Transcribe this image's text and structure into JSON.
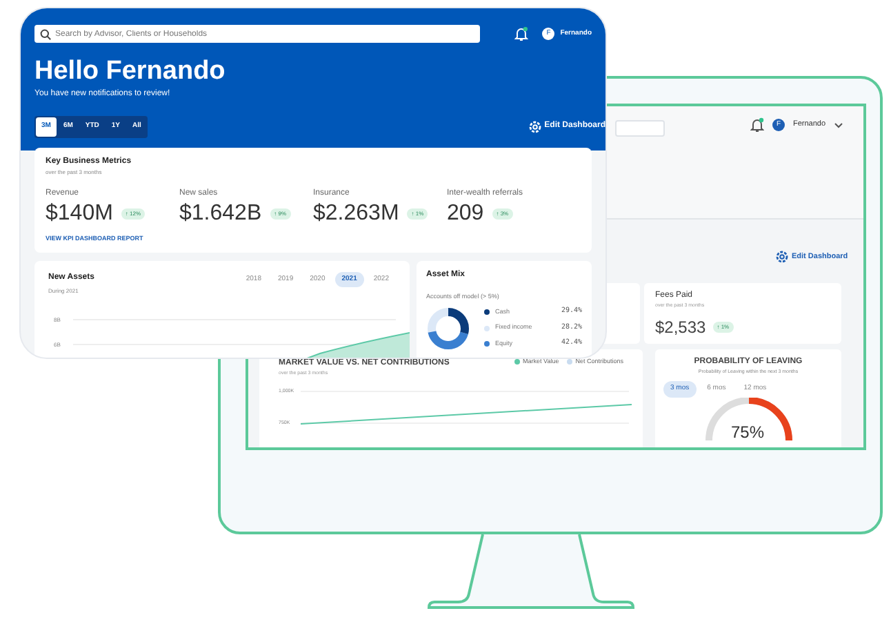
{
  "front": {
    "search": {
      "placeholder": "Search by Advisor, Clients or Households"
    },
    "user": {
      "initial": "F",
      "name": "Fernando"
    },
    "greeting": "Hello Fernando",
    "subtitle": "You have new notifications to review!",
    "periods": [
      {
        "label": "3M",
        "selected": true
      },
      {
        "label": "6M",
        "selected": false
      },
      {
        "label": "YTD",
        "selected": false
      },
      {
        "label": "1Y",
        "selected": false
      },
      {
        "label": "All",
        "selected": false
      }
    ],
    "edit_button": "Edit Dashboard",
    "kpi": {
      "title": "Key Business Metrics",
      "subtitle": "over the past 3 months",
      "metrics": [
        {
          "label": "Revenue",
          "value": "$140M",
          "change": "↑ 12%"
        },
        {
          "label": "New sales",
          "value": "$1.642B",
          "change": "↑ 9%"
        },
        {
          "label": "Insurance",
          "value": "$2.263M",
          "change": "↑ 1%"
        },
        {
          "label": "Inter-wealth referrals",
          "value": "209",
          "change": "↑ 3%"
        }
      ],
      "link": "VIEW KPI DASHBOARD REPORT"
    },
    "new_assets": {
      "title": "New Assets",
      "subtitle": "During 2021",
      "years": [
        {
          "label": "2018",
          "selected": false
        },
        {
          "label": "2019",
          "selected": false
        },
        {
          "label": "2020",
          "selected": false
        },
        {
          "label": "2021",
          "selected": true
        },
        {
          "label": "2022",
          "selected": false
        }
      ],
      "ticks": [
        "8B",
        "6B"
      ]
    },
    "asset_mix": {
      "title": "Asset Mix",
      "subtitle": "Accounts off model (> 5%)",
      "legend": [
        {
          "label": "Cash",
          "value": "29.4%",
          "color": "#0b3b7a"
        },
        {
          "label": "Fixed income",
          "value": "28.2%",
          "color": "#dce8f7"
        },
        {
          "label": "Equity",
          "value": "42.4%",
          "color": "#3a7fd0"
        }
      ]
    }
  },
  "back": {
    "user": {
      "initial": "F",
      "name": "Fernando"
    },
    "edit_button": "Edit Dashboard",
    "fees": {
      "title": "Fees Paid",
      "subtitle": "over the past 3 months",
      "value": "$2,533",
      "change": "↑ 1%"
    },
    "market": {
      "title": "MARKET VALUE VS. NET CONTRIBUTIONS",
      "subtitle": "over the past 3 months",
      "legend": [
        {
          "label": "Market Value",
          "color": "#5cc9a7"
        },
        {
          "label": "Net Contributions",
          "color": "#c9dcf0"
        }
      ],
      "ticks": [
        "1,000K",
        "750K"
      ]
    },
    "leaving": {
      "title": "PROBABILITY OF LEAVING",
      "subtitle": "Probability of Leaving within the next 3 months",
      "periods": [
        {
          "label": "3 mos",
          "selected": true
        },
        {
          "label": "6 mos",
          "selected": false
        },
        {
          "label": "12 mos",
          "selected": false
        }
      ],
      "value": "75%"
    }
  }
}
